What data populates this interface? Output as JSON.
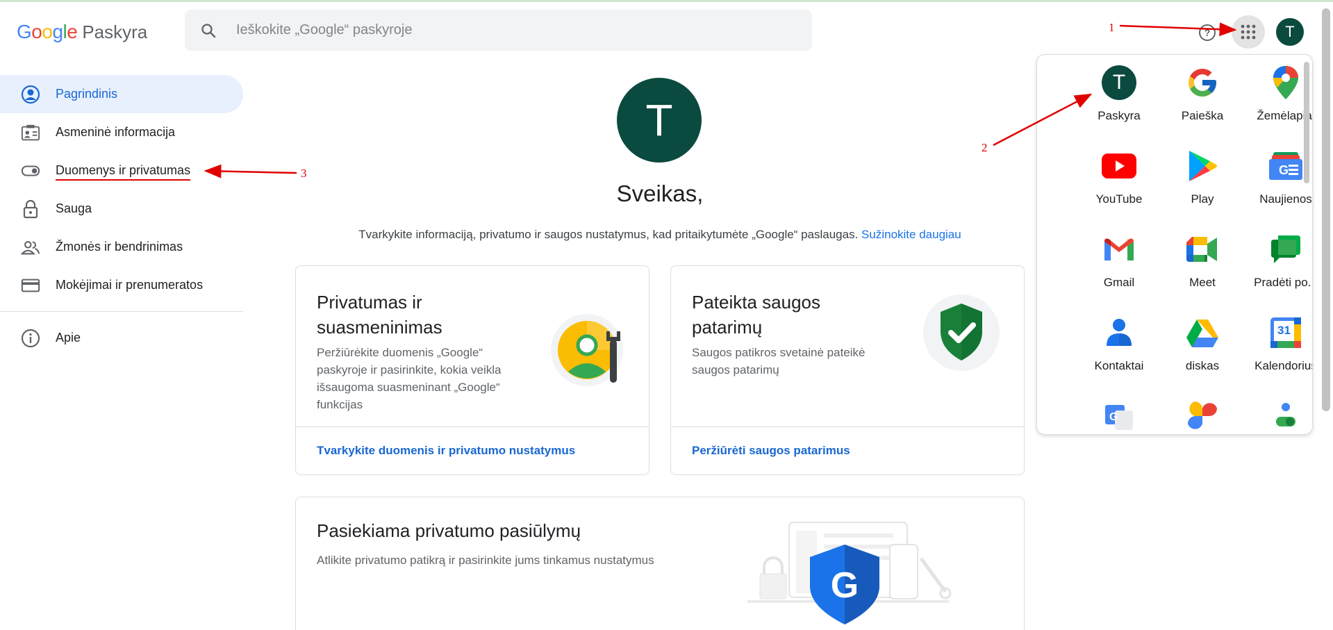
{
  "header": {
    "logo_google": "Google",
    "logo_product": "Paskyra",
    "search_placeholder": "Ieškokite „Google“ paskyroje",
    "avatar_letter": "T"
  },
  "sidebar": {
    "items": [
      {
        "label": "Pagrindinis",
        "icon": "account-circle-icon"
      },
      {
        "label": "Asmeninė informacija",
        "icon": "id-card-icon"
      },
      {
        "label": "Duomenys ir privatumas",
        "icon": "toggle-icon"
      },
      {
        "label": "Sauga",
        "icon": "lock-icon"
      },
      {
        "label": "Žmonės ir bendrinimas",
        "icon": "people-icon"
      },
      {
        "label": "Mokėjimai ir prenumeratos",
        "icon": "credit-card-icon"
      },
      {
        "label": "Apie",
        "icon": "info-icon"
      }
    ]
  },
  "main": {
    "avatar_letter": "T",
    "greeting": "Sveikas,",
    "intro_text": "Tvarkykite informaciją, privatumo ir saugos nustatymus, kad pritaikytumėte „Google“ paslaugas.",
    "intro_link": "Sužinokite daugiau",
    "cards": [
      {
        "title_line1": "Privatumas ir",
        "title_line2": "suasmeninimas",
        "desc_lines": [
          "Peržiūrėkite duomenis „Google“",
          "paskyroje ir pasirinkite, kokia veikla",
          "išsaugoma suasmeninant „Google“",
          "funkcijas"
        ],
        "link": "Tvarkykite duomenis ir privatumo nustatymus"
      },
      {
        "title_line1": "Pateikta saugos",
        "title_line2": "patarimų",
        "desc_lines": [
          "Saugos patikros svetainė pateikė",
          "saugos patarimų"
        ],
        "link": "Peržiūrėti saugos patarimus"
      },
      {
        "title": "Pasiekiama privatumo pasiūlymų",
        "desc": "Atlikite privatumo patikrą ir pasirinkite jums tinkamus nustatymus"
      }
    ]
  },
  "apps_panel": {
    "apps": [
      {
        "label": "Paskyra",
        "icon": "account-avatar-icon"
      },
      {
        "label": "Paieška",
        "icon": "google-g-icon"
      },
      {
        "label": "Žemėlapiai",
        "icon": "maps-pin-icon"
      },
      {
        "label": "YouTube",
        "icon": "youtube-icon"
      },
      {
        "label": "Play",
        "icon": "play-store-icon"
      },
      {
        "label": "Naujienos",
        "icon": "news-icon"
      },
      {
        "label": "Gmail",
        "icon": "gmail-icon"
      },
      {
        "label": "Meet",
        "icon": "meet-icon"
      },
      {
        "label": "Pradėti po...",
        "icon": "chat-icon"
      },
      {
        "label": "Kontaktai",
        "icon": "contacts-icon"
      },
      {
        "label": "diskas",
        "icon": "drive-icon"
      },
      {
        "label": "Kalendorius",
        "icon": "calendar-icon"
      }
    ],
    "calendar_day": "31",
    "avatar_letter": "T"
  },
  "annotations": {
    "n1": "1",
    "n2": "2",
    "n3": "3",
    "color": "#e00000"
  },
  "colors": {
    "accent": "#1a73e8",
    "active_bg": "#e8f0fe",
    "avatar": "#0b4a3e"
  }
}
